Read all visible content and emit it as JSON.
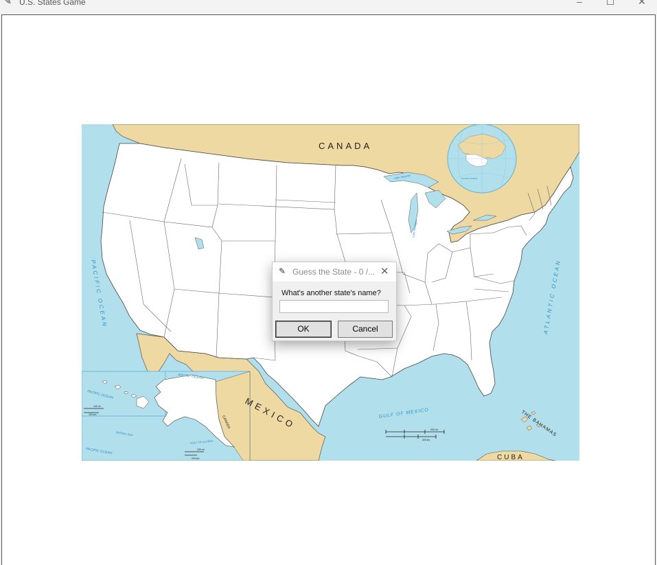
{
  "window": {
    "title": "U.S. States Game",
    "minimize": "–",
    "maximize": "☐",
    "close": "✕"
  },
  "map": {
    "labels": {
      "canada": "CANADA",
      "mexico": "MEXICO",
      "pacific_ocean": "PACIFIC OCEAN",
      "atlantic_ocean": "ATLANTIC OCEAN",
      "gulf_of_mexico": "GULF OF MEXICO",
      "the_bahamas": "THE BAHAMAS",
      "cuba": "CUBA",
      "lake_michigan": "Lake Michigan",
      "lake_superior": "Lake Superior",
      "arctic_ocean": "ARCTIC OCEAN",
      "bering_sea": "BERING SEA",
      "gulf_of_alaska": "GULF OF ALASKA",
      "canada_small": "CANADA",
      "pacific_ocean_small": "PACIFIC OCEAN",
      "pacific_ocean_small_2": "PACIFIC OCEAN",
      "pacific_ocean_globe": "PACIFIC OCEAN",
      "scale_mi": "300 mi",
      "scale_km": "300 km",
      "hawaii_mi": "100 mi",
      "hawaii_km": "100 km",
      "alaska_mi": "200 mi",
      "alaska_km": "200 km"
    },
    "colors": {
      "water": "#b2dfec",
      "land_foreign": "#efd9a3",
      "land_us": "#ffffff",
      "border": "#555555",
      "label_blue": "#2d8fc2"
    }
  },
  "dialog": {
    "title": "Guess the State - 0 /...",
    "close": "✕",
    "prompt": "What's another state's name?",
    "input_value": "",
    "ok_label": "OK",
    "cancel_label": "Cancel"
  },
  "icons": {
    "app": "feather-icon",
    "dialog": "feather-icon"
  }
}
